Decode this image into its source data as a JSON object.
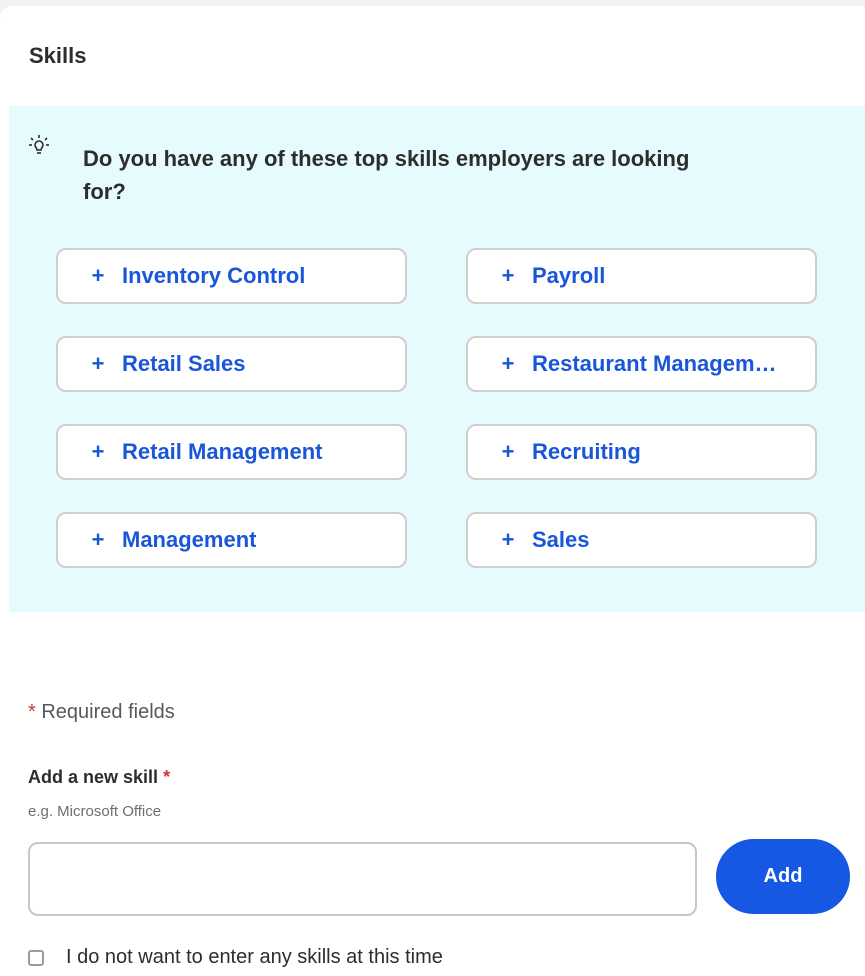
{
  "section": {
    "title": "Skills"
  },
  "suggestions": {
    "prompt": "Do you have any of these top skills employers are looking for?",
    "icon": "lightbulb-icon",
    "add_symbol": "+",
    "chips": [
      {
        "label": "Inventory Control"
      },
      {
        "label": "Payroll"
      },
      {
        "label": "Retail Sales"
      },
      {
        "label": "Restaurant Management"
      },
      {
        "label": "Retail Management"
      },
      {
        "label": "Recruiting"
      },
      {
        "label": "Management"
      },
      {
        "label": "Sales"
      }
    ]
  },
  "form": {
    "required_asterisk": "*",
    "required_note": "Required fields",
    "skill_label": "Add a new skill",
    "skill_hint": "e.g. Microsoft Office",
    "skill_value": "",
    "add_label": "Add",
    "optout_label": "I do not want to enter any skills at this time"
  },
  "colors": {
    "accent": "#1657e4",
    "chip_text": "#1a56d8",
    "panel_bg": "#e6fbfd",
    "required": "#d13535"
  }
}
